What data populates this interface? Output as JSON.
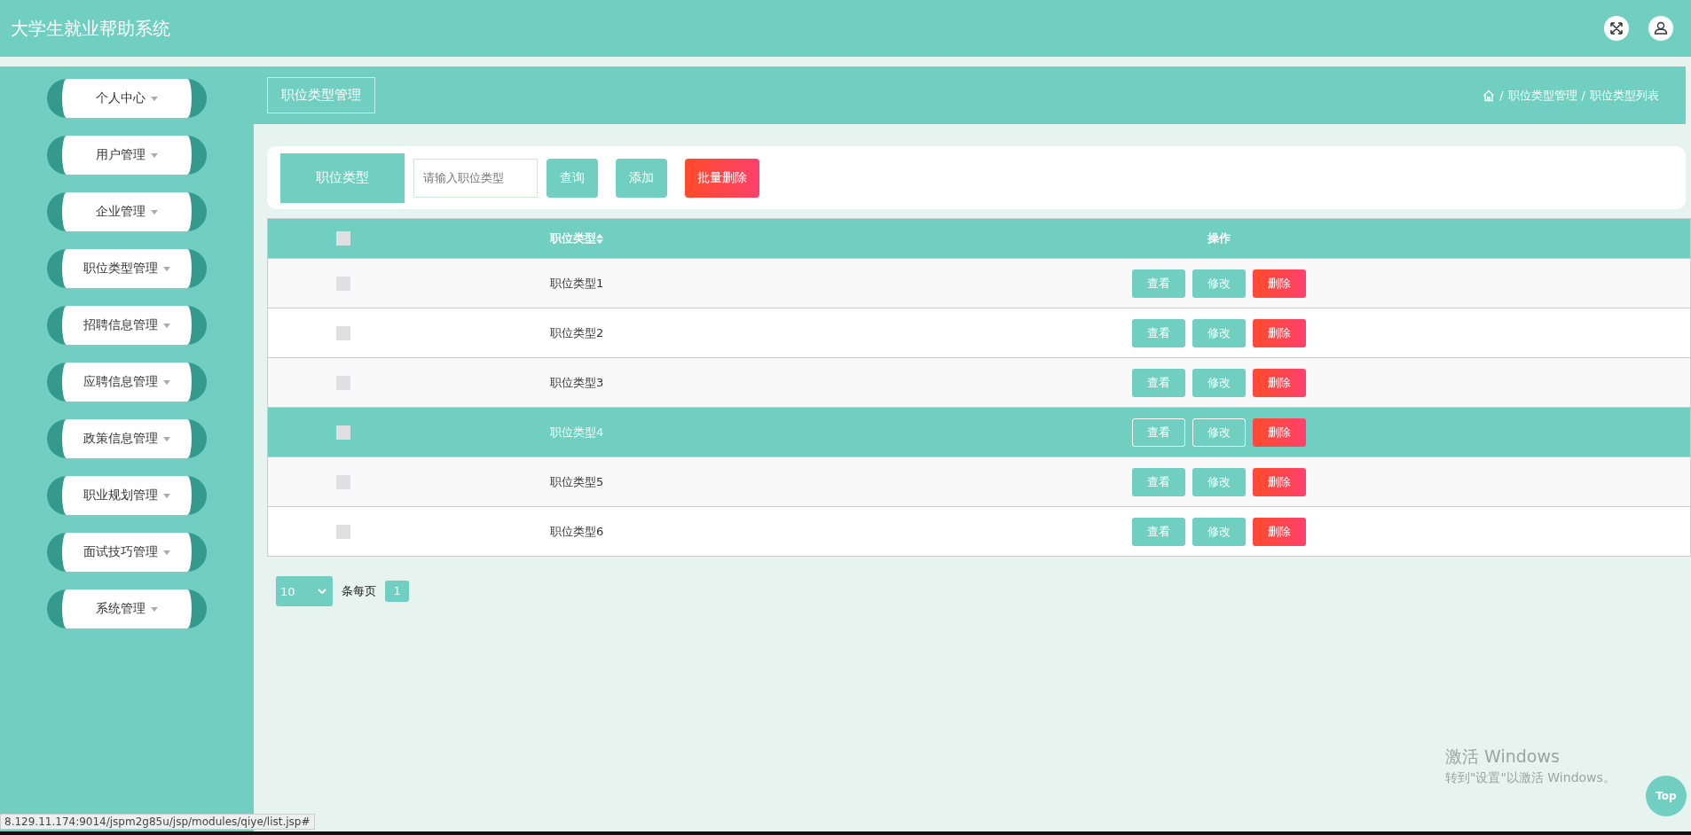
{
  "header": {
    "title": "大学生就业帮助系统"
  },
  "sidebar": {
    "items": [
      {
        "label": "个人中心"
      },
      {
        "label": "用户管理"
      },
      {
        "label": "企业管理"
      },
      {
        "label": "职位类型管理"
      },
      {
        "label": "招聘信息管理"
      },
      {
        "label": "应聘信息管理"
      },
      {
        "label": "政策信息管理"
      },
      {
        "label": "职业规划管理"
      },
      {
        "label": "面试技巧管理"
      },
      {
        "label": "系统管理"
      }
    ]
  },
  "page_header": {
    "title": "职位类型管理",
    "breadcrumb": [
      "职位类型管理",
      "职位类型列表"
    ],
    "separator": "/"
  },
  "search": {
    "label": "职位类型",
    "placeholder": "请输入职位类型",
    "buttons": [
      {
        "label": "查询",
        "kind": "primary"
      },
      {
        "label": "添加",
        "kind": "primary"
      },
      {
        "label": "批量删除",
        "kind": "danger"
      }
    ]
  },
  "table": {
    "columns": [
      "职位类型",
      "操作"
    ],
    "all_checked": false,
    "rows": [
      {
        "name": "职位类型1",
        "checked": false,
        "highlighted": false,
        "actions": [
          "查看",
          "修改",
          "删除"
        ]
      },
      {
        "name": "职位类型2",
        "checked": false,
        "highlighted": false,
        "actions": [
          "查看",
          "修改",
          "删除"
        ]
      },
      {
        "name": "职位类型3",
        "checked": false,
        "highlighted": false,
        "actions": [
          "查看",
          "修改",
          "删除"
        ]
      },
      {
        "name": "职位类型4",
        "checked": false,
        "highlighted": true,
        "actions": [
          "查看",
          "修改",
          "删除"
        ]
      },
      {
        "name": "职位类型5",
        "checked": false,
        "highlighted": false,
        "actions": [
          "查看",
          "修改",
          "删除"
        ]
      },
      {
        "name": "职位类型6",
        "checked": false,
        "highlighted": false,
        "actions": [
          "查看",
          "修改",
          "删除"
        ]
      }
    ]
  },
  "pagination": {
    "page_size": "10",
    "page_size_label": "条每页",
    "pages": [
      {
        "label": "1",
        "selected": true
      }
    ]
  },
  "activation_notice": {
    "title": "激活 Windows",
    "subtitle": "转到\"设置\"以激活 Windows。"
  },
  "top_button": "Top",
  "status_url": "8.129.11.174:9014/jspm2g85u/jsp/modules/qiye/list.jsp#"
}
